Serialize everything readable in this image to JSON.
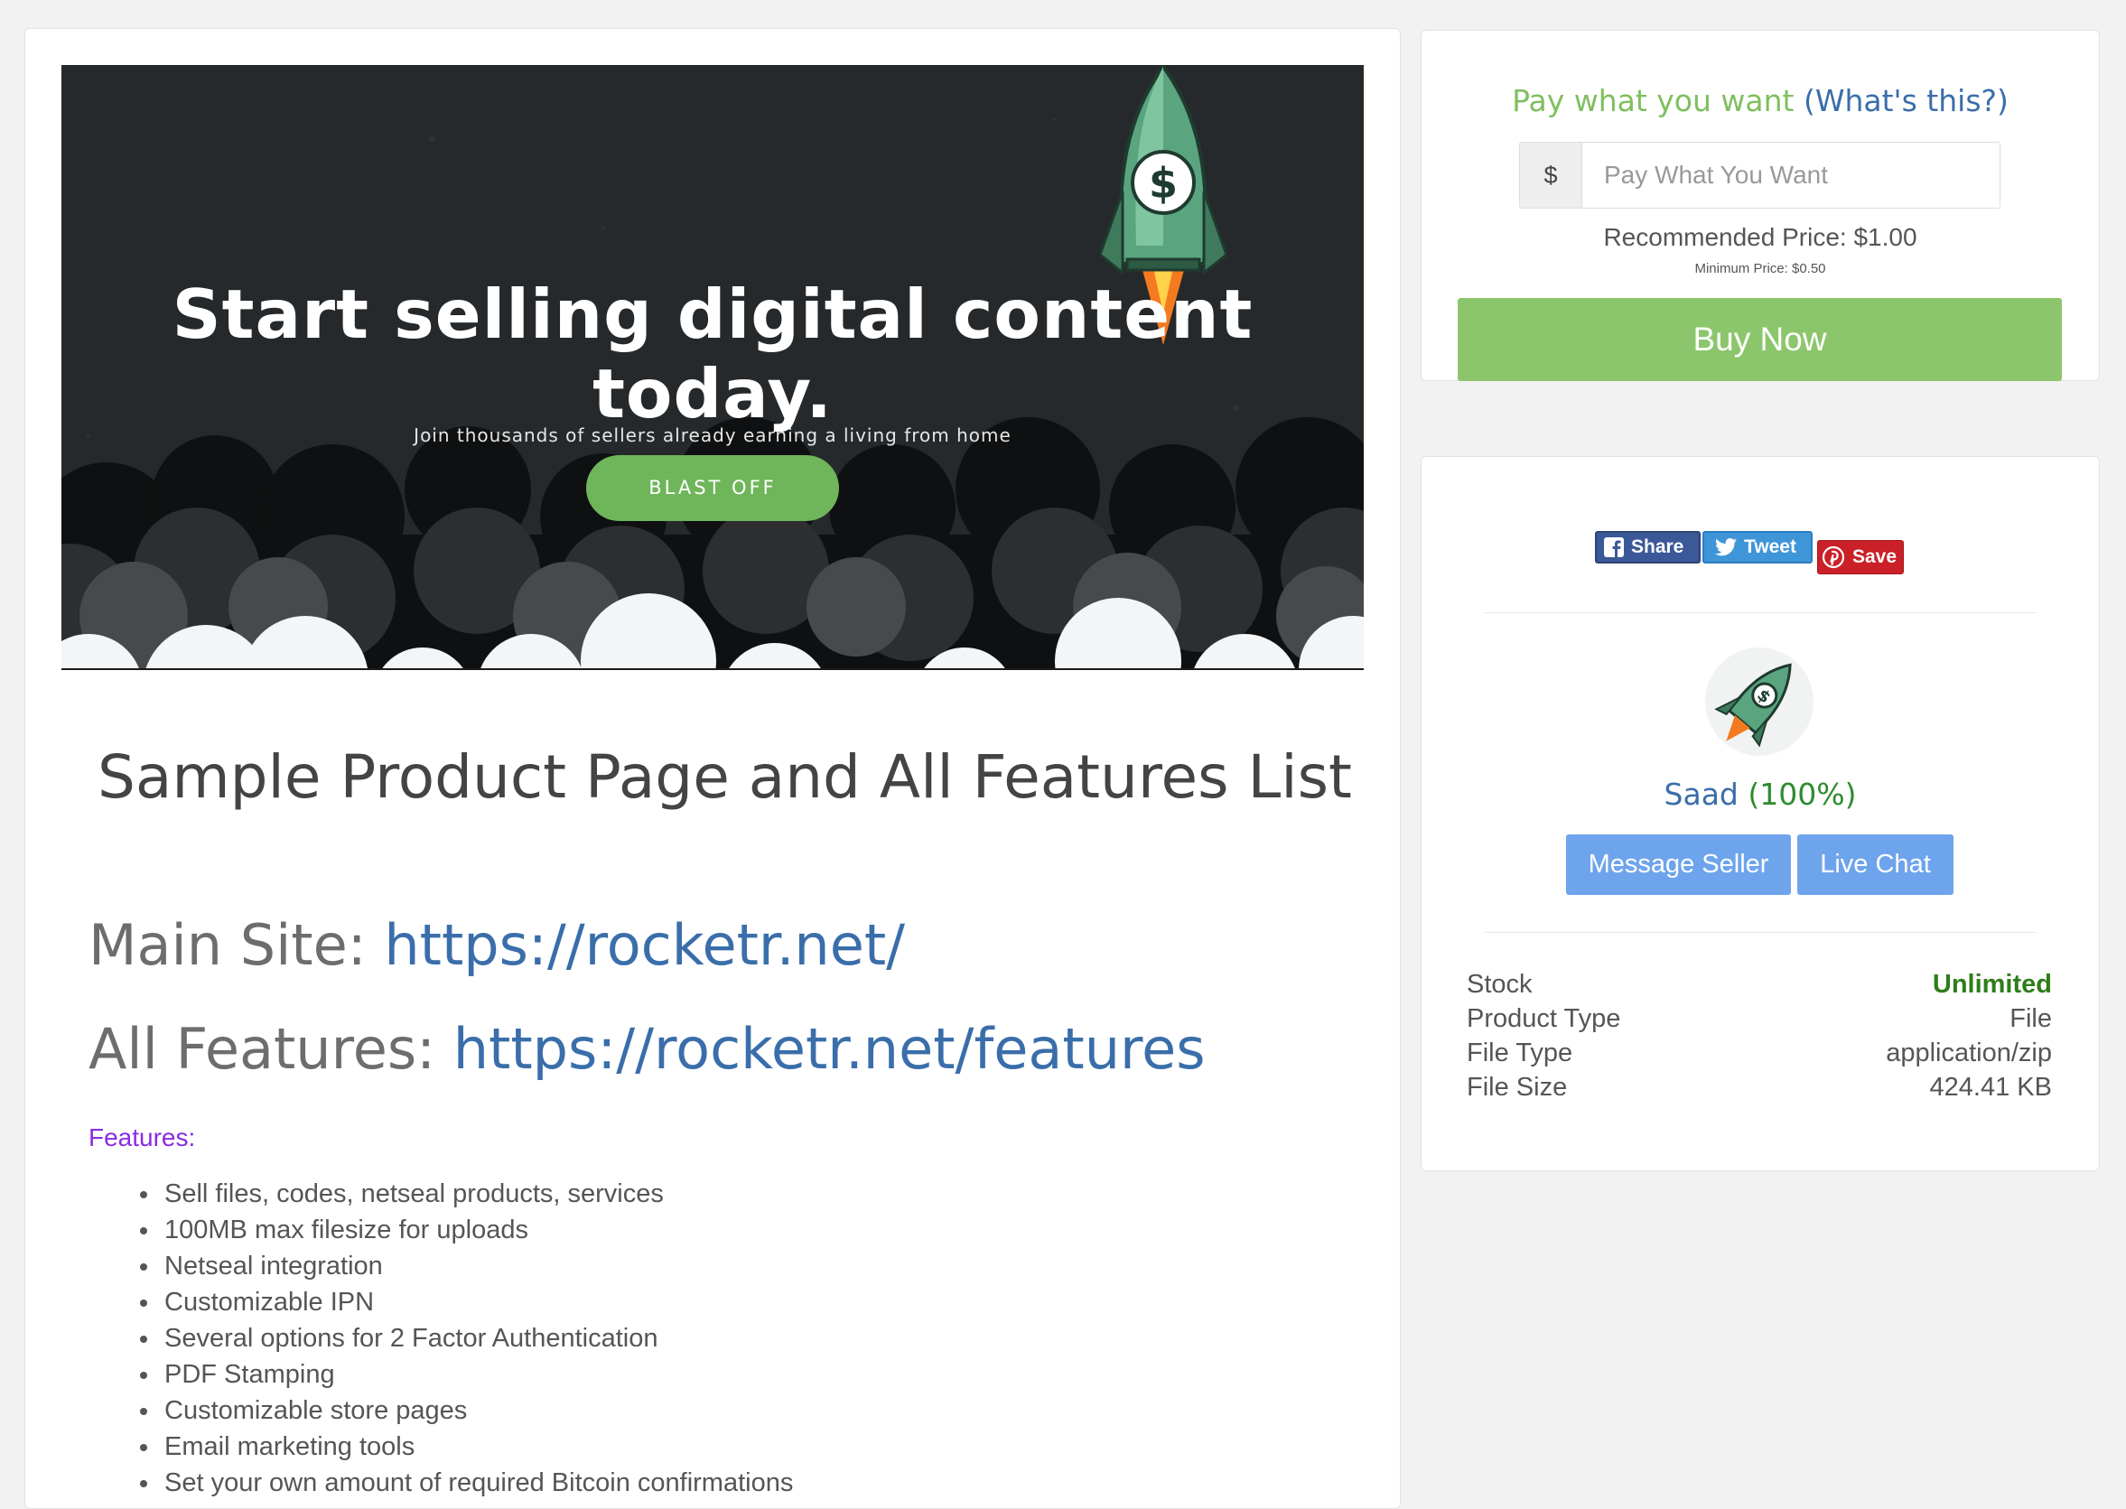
{
  "banner": {
    "title": "Start selling digital content today.",
    "subtitle": "Join thousands of sellers already earning a living from home",
    "button_label": "BLAST OFF"
  },
  "product": {
    "title": "Sample Product Page and All Features List",
    "main_site_label": "Main Site: ",
    "main_site_url": "https://rocketr.net/",
    "all_features_label": "All Features: ",
    "all_features_url": "https://rocketr.net/features",
    "features_heading": "Features:",
    "features": [
      "Sell files, codes, netseal products, services",
      "100MB max filesize for uploads",
      "Netseal integration",
      "Customizable IPN",
      "Several options for 2 Factor Authentication",
      "PDF Stamping",
      "Customizable store pages",
      "Email marketing tools",
      "Set your own amount of required Bitcoin confirmations"
    ]
  },
  "purchase": {
    "pwyw_label": "Pay what you want",
    "whats_this": "(What's this?)",
    "currency_symbol": "$",
    "price_placeholder": "Pay What You Want",
    "price_value": "",
    "recommended": "Recommended Price: $1.00",
    "minimum": "Minimum Price: $0.50",
    "buy_label": "Buy Now"
  },
  "social": {
    "share_label": "Share",
    "tweet_label": "Tweet",
    "save_label": "Save"
  },
  "seller": {
    "name": "Saad",
    "rating": "(100%)",
    "message_label": "Message Seller",
    "chat_label": "Live Chat"
  },
  "specs": [
    {
      "label": "Stock",
      "value": "Unlimited"
    },
    {
      "label": "Product Type",
      "value": "File"
    },
    {
      "label": "File Type",
      "value": "application/zip"
    },
    {
      "label": "File Size",
      "value": "424.41 KB"
    }
  ],
  "colors": {
    "accent_green": "#8cc66c",
    "link_blue": "#3a6eaa",
    "seller_button_blue": "#6ea4ec",
    "stock_green": "#2e7d1a"
  }
}
